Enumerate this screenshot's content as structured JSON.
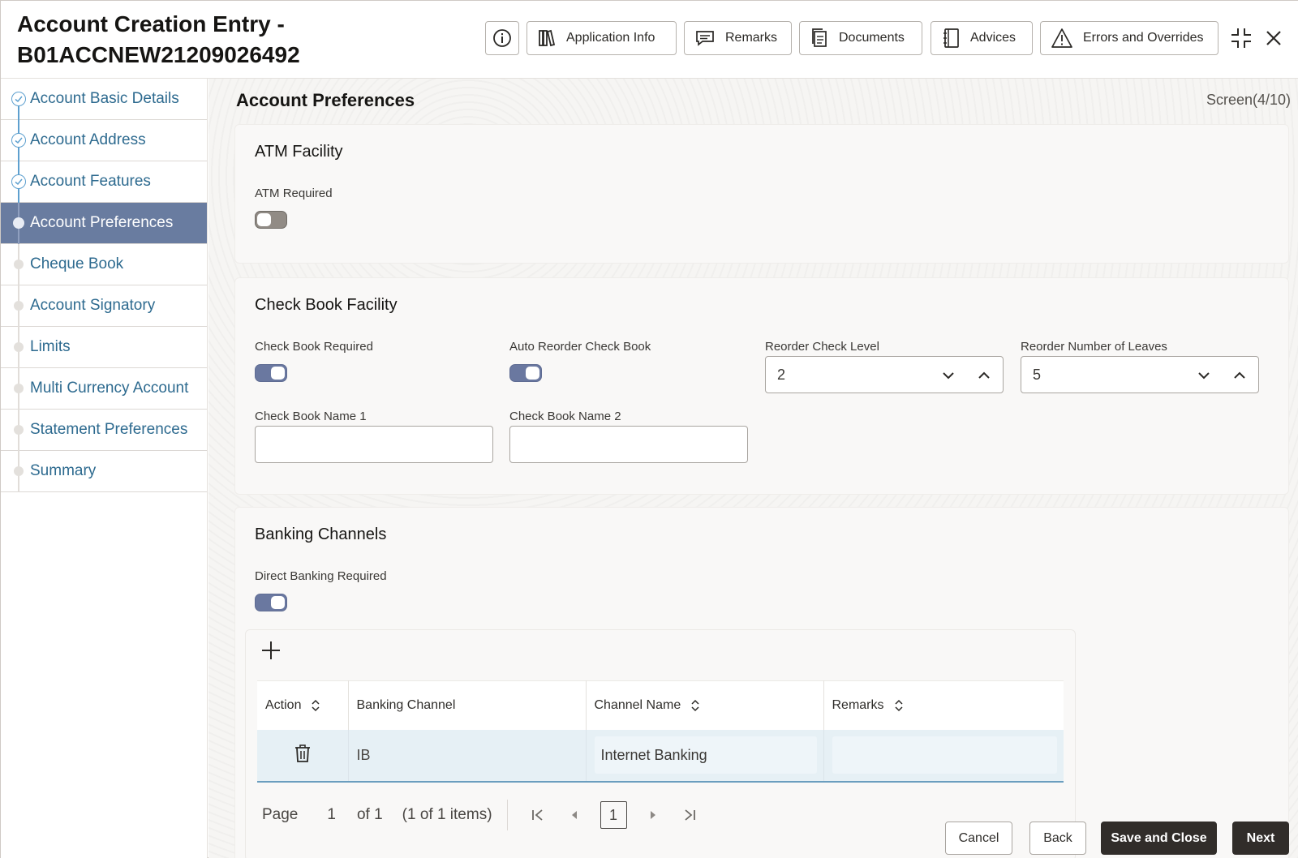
{
  "header": {
    "title": "Account Creation Entry - B01ACCNEW21209026492",
    "buttons": {
      "application_info": "Application Info",
      "remarks": "Remarks",
      "documents": "Documents",
      "advices": "Advices",
      "errors": "Errors and Overrides"
    },
    "icons": [
      "info-icon",
      "books-icon",
      "chat-icon",
      "documents-icon",
      "notebook-icon",
      "warning-icon",
      "minimize-icon",
      "close-icon"
    ]
  },
  "sidebar": {
    "items": [
      {
        "label": "Account Basic Details",
        "state": "done"
      },
      {
        "label": "Account Address",
        "state": "done"
      },
      {
        "label": "Account Features",
        "state": "done"
      },
      {
        "label": "Account Preferences",
        "state": "active"
      },
      {
        "label": "Cheque Book",
        "state": "pending"
      },
      {
        "label": "Account Signatory",
        "state": "pending"
      },
      {
        "label": "Limits",
        "state": "pending"
      },
      {
        "label": "Multi Currency Account",
        "state": "pending"
      },
      {
        "label": "Statement Preferences",
        "state": "pending"
      },
      {
        "label": "Summary",
        "state": "pending"
      }
    ]
  },
  "main": {
    "section_title": "Account Preferences",
    "screen_indicator": "Screen(4/10)",
    "atm": {
      "title": "ATM Facility",
      "atm_required_label": "ATM Required",
      "atm_required": false
    },
    "check_book": {
      "title": "Check Book Facility",
      "required_label": "Check Book Required",
      "required": true,
      "auto_reorder_label": "Auto Reorder Check Book",
      "auto_reorder": true,
      "reorder_level_label": "Reorder Check Level",
      "reorder_level_value": "2",
      "reorder_leaves_label": "Reorder Number of Leaves",
      "reorder_leaves_value": "5",
      "name1_label": "Check Book Name 1",
      "name1_value": "",
      "name2_label": "Check Book Name 2",
      "name2_value": ""
    },
    "banking": {
      "title": "Banking Channels",
      "direct_label": "Direct Banking Required",
      "direct_required": true,
      "columns": {
        "action": "Action",
        "channel": "Banking Channel",
        "name": "Channel Name",
        "remarks": "Remarks"
      },
      "rows": [
        {
          "channel": "IB",
          "name": "Internet Banking",
          "remarks": ""
        }
      ],
      "pager": {
        "page_label": "Page",
        "page": "1",
        "of": "of 1",
        "items": "(1 of 1 items)",
        "current": "1"
      }
    }
  },
  "footer": {
    "cancel": "Cancel",
    "back": "Back",
    "save_close": "Save and Close",
    "next": "Next"
  },
  "colors": {
    "active_nav": "#697ca0",
    "toggle_on": "#6a78a0",
    "primary_button": "#312d2a",
    "row_highlight": "#e6f0f5"
  }
}
